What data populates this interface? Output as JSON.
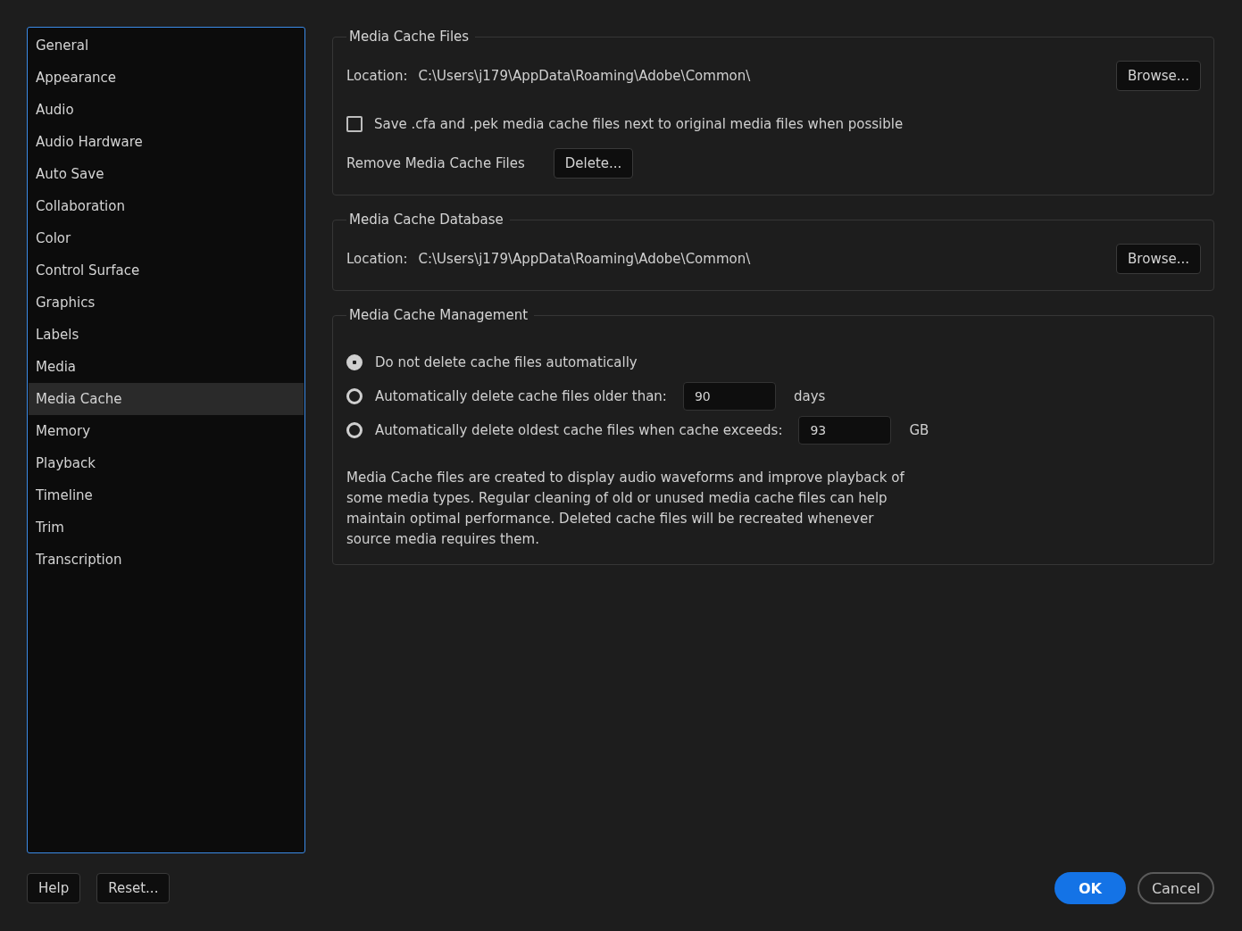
{
  "sidebar": {
    "items": [
      {
        "label": "General",
        "selected": false
      },
      {
        "label": "Appearance",
        "selected": false
      },
      {
        "label": "Audio",
        "selected": false
      },
      {
        "label": "Audio Hardware",
        "selected": false
      },
      {
        "label": "Auto Save",
        "selected": false
      },
      {
        "label": "Collaboration",
        "selected": false
      },
      {
        "label": "Color",
        "selected": false
      },
      {
        "label": "Control Surface",
        "selected": false
      },
      {
        "label": "Graphics",
        "selected": false
      },
      {
        "label": "Labels",
        "selected": false
      },
      {
        "label": "Media",
        "selected": false
      },
      {
        "label": "Media Cache",
        "selected": true
      },
      {
        "label": "Memory",
        "selected": false
      },
      {
        "label": "Playback",
        "selected": false
      },
      {
        "label": "Timeline",
        "selected": false
      },
      {
        "label": "Trim",
        "selected": false
      },
      {
        "label": "Transcription",
        "selected": false
      }
    ]
  },
  "media_cache_files": {
    "title": "Media Cache Files",
    "location_label": "Location:",
    "location": "C:\\Users\\j179\\AppData\\Roaming\\Adobe\\Common\\",
    "browse_button": "Browse...",
    "save_next_to_media": {
      "label": "Save .cfa and .pek media cache files next to original media files when possible",
      "checked": false
    },
    "remove_label": "Remove Media Cache Files",
    "delete_button": "Delete..."
  },
  "media_cache_database": {
    "title": "Media Cache Database",
    "location_label": "Location:",
    "location": "C:\\Users\\j179\\AppData\\Roaming\\Adobe\\Common\\",
    "browse_button": "Browse..."
  },
  "media_cache_management": {
    "title": "Media Cache Management",
    "options": [
      {
        "label": "Do not delete cache files automatically",
        "selected": true
      },
      {
        "label": "Automatically delete cache files older than:",
        "selected": false,
        "value": "90",
        "unit": "days"
      },
      {
        "label": "Automatically delete oldest cache files when cache exceeds:",
        "selected": false,
        "value": "93",
        "unit": "GB"
      }
    ],
    "description": "Media Cache files are created to display audio waveforms and improve playback of some media types.  Regular cleaning of old or unused media cache files can help maintain optimal performance. Deleted cache files will be recreated whenever source media requires them."
  },
  "footer": {
    "help_button": "Help",
    "reset_button": "Reset...",
    "ok_button": "OK",
    "cancel_button": "Cancel"
  }
}
